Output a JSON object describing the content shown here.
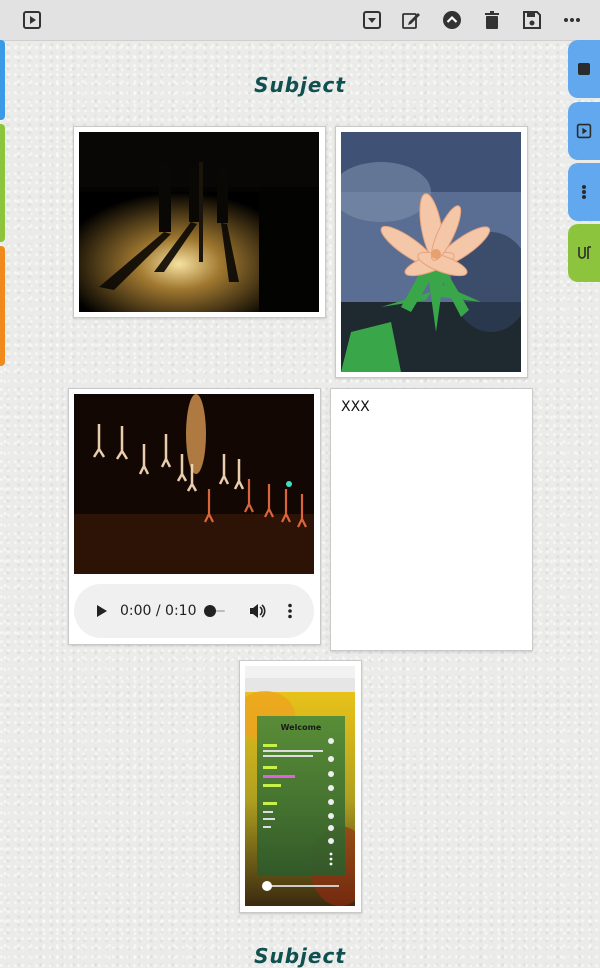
{
  "toolbar": {
    "icons": [
      "play-box-icon",
      "dropdown-box-icon",
      "edit-icon",
      "chevron-up-circle-icon",
      "trash-icon",
      "save-icon",
      "more-horizontal-icon"
    ]
  },
  "side_tabs": {
    "left_colors": [
      "#3a9ae8",
      "#8cc43e",
      "#f08a1c"
    ],
    "right": [
      {
        "icon": "stop-icon",
        "color": "#62a8ee"
      },
      {
        "icon": "play-box-icon",
        "color": "#62a8ee"
      },
      {
        "icon": "more-vertical-icon",
        "color": "#62a8ee"
      },
      {
        "icon": "rotate-text-icon",
        "color": "#8cc43e"
      }
    ]
  },
  "page": {
    "subject_title": "Subject",
    "subject_title_bottom": "Subject"
  },
  "note": {
    "text": "XXX"
  },
  "audio": {
    "time": "0:00 / 0:10",
    "progress": 0
  },
  "thumbnail": {
    "welcome": "Welcome"
  },
  "colors": {
    "title": "#0f5150",
    "toolbar_bg": "#e2e2e2",
    "tab_blue": "#62a8ee",
    "tab_green": "#8cc43e"
  }
}
